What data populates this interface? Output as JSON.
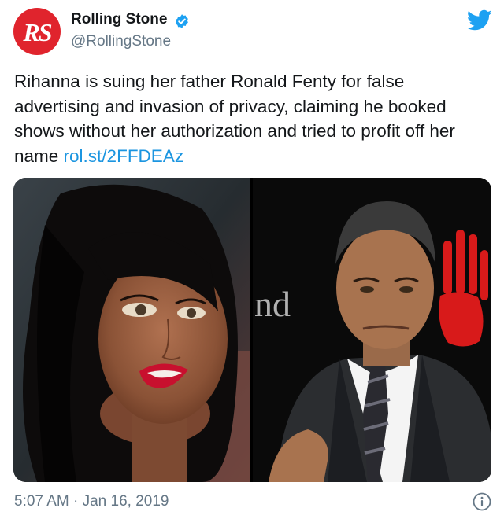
{
  "author": {
    "avatar_text": "RS",
    "name": "Rolling Stone",
    "handle": "@RollingStone",
    "verified": true
  },
  "tweet": {
    "text": "Rihanna is suing her father Ronald Fenty for false advertising and invasion of privacy, claiming he booked shows without her authorization and tried to profit off her name ",
    "link": "rol.st/2FFDEAz"
  },
  "media": {
    "left_photo": "Close-up portrait of Rihanna with dark hair and red lipstick",
    "right_photo": "Ronald Fenty in a dark suit, white shirt and striped tie in front of a backdrop with a red handprint",
    "backdrop_text": "nd"
  },
  "footer": {
    "timestamp": "5:07 AM · Jan 16, 2019"
  },
  "icons": {
    "platform": "twitter-bird-icon",
    "verified": "verified-badge-icon",
    "info": "info-icon"
  },
  "colors": {
    "brand_red": "#e0242d",
    "link_blue": "#1b95e0",
    "twitter_blue": "#1da1f2",
    "muted_text": "#657786"
  }
}
